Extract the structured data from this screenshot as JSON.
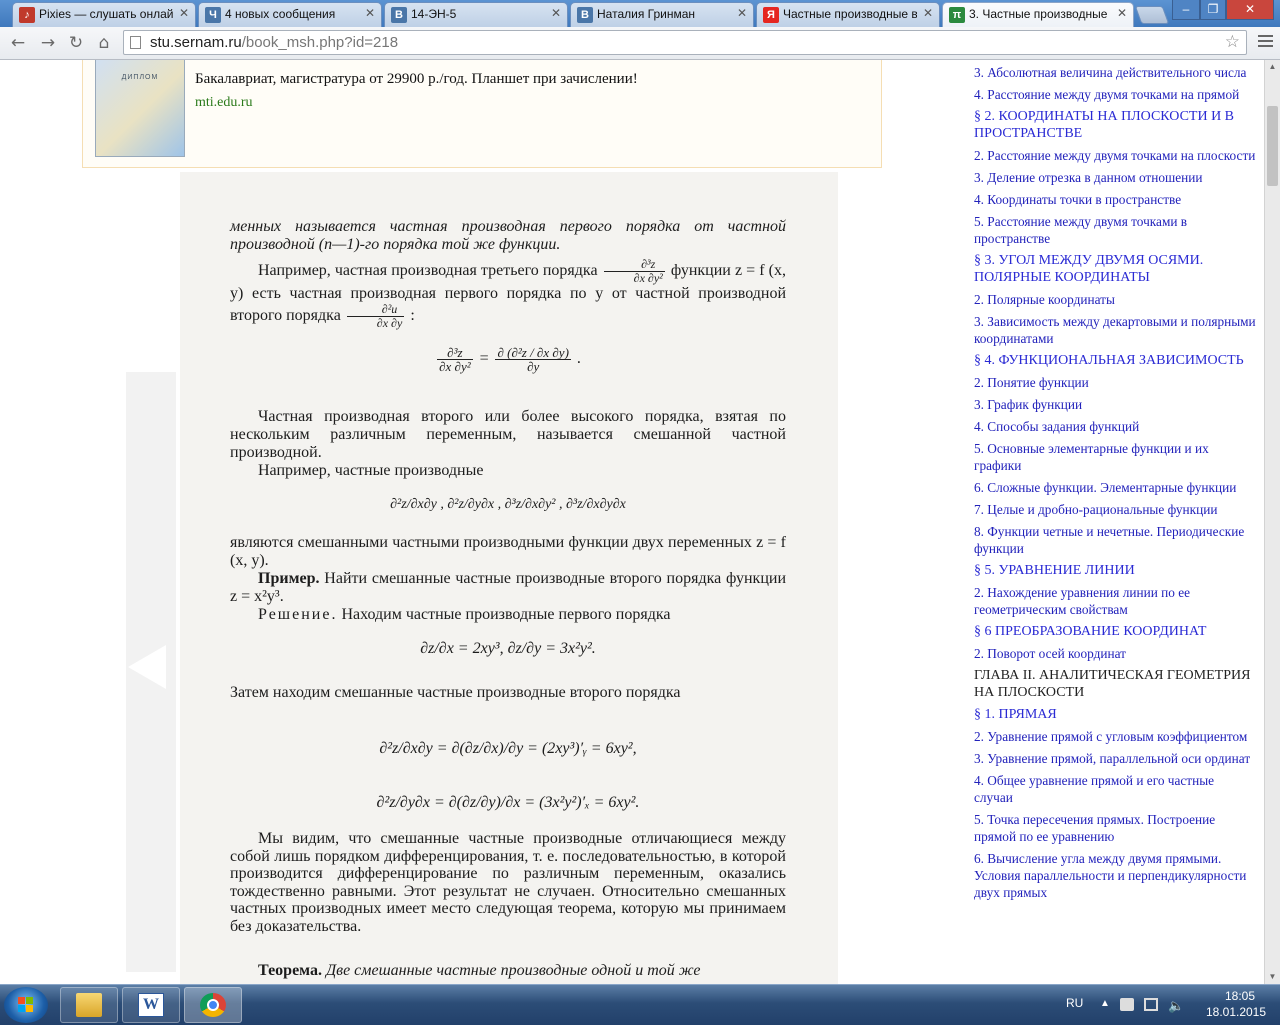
{
  "browser": {
    "tabs": [
      {
        "title": "Pixies — слушать онлайн",
        "icon": "music-note-icon",
        "color": "#c0392b",
        "active": false
      },
      {
        "title": "4 новых сообщения",
        "icon": "chat-icon",
        "color": "#4a76a8",
        "active": false
      },
      {
        "title": "14-ЭН-5",
        "icon": "vk-icon",
        "color": "#4a76a8",
        "active": false
      },
      {
        "title": "Наталия Гринман",
        "icon": "vk-icon",
        "color": "#4a76a8",
        "active": false
      },
      {
        "title": "Частные производные в",
        "icon": "yandex-icon",
        "color": "#e52620",
        "active": false
      },
      {
        "title": "3. Частные производные",
        "icon": "pi-icon",
        "color": "#2b8a3e",
        "active": true
      }
    ],
    "url_host": "stu.sernam.ru",
    "url_path": "/book_msh.php?id=218"
  },
  "ad": {
    "image_caption": "ДИПЛОМ",
    "text": "Бакалавриат, магистратура от 29900 р./год. Планшет при зачислении!",
    "url": "mti.edu.ru"
  },
  "book": {
    "p1": "менных называется частная производная первого порядка от частной производной (n—1)-го порядка той же функции.",
    "p2a": "Например, частная производная третьего порядка",
    "p2b": "функции z = f (x, y) есть частная производная первого порядка по y от частной производной второго порядка",
    "f_d3z_dxdy2_n": "∂³z",
    "f_d3z_dxdy2_d": "∂x ∂y²",
    "f_d2u_dxdy_n": "∂²u",
    "f_d2u_dxdy_d": "∂x ∂y",
    "eq1_rhs_n": "∂ (∂²z / ∂x ∂y)",
    "eq1_rhs_d": "∂y",
    "p3": "Частная производная второго или более высокого порядка, взятая по нескольким различным переменным, называется смешанной частной производной.",
    "p4": "Например, частные производные",
    "mixed_list": "∂²z/∂x∂y ,  ∂²z/∂y∂x ,  ∂³z/∂x∂y² ,  ∂³z/∂x∂y∂x",
    "p5": "являются смешанными частными производными функции двух переменных z = f (x, y).",
    "example_label": "Пример.",
    "example_text": "Найти смешанные частные производные второго порядка функции z = x²y³.",
    "solution_label": "Решение.",
    "solution_text": "Находим частные производные первого порядка",
    "first_order": "∂z/∂x = 2xy³,      ∂z/∂y = 3x²y².",
    "p6": "Затем находим смешанные частные производные второго порядка",
    "mixed_eq1": "∂²z/∂x∂y = ∂(∂z/∂x)/∂y = (2xy³)′ᵧ = 6xy²,",
    "mixed_eq2": "∂²z/∂y∂x = ∂(∂z/∂y)/∂x = (3x²y²)′ₓ = 6xy².",
    "p7a": "Мы видим, что смешанные частные производные",
    "p7b": "отличающиеся между собой лишь порядком дифференцирования, т. е. последовательностью, в которой производится дифференцирование по различным переменным, оказались тождественно равными. Этот результат не случаен. Относительно смешанных частных производных имеет место следующая теорема, которую мы принимаем без доказательства.",
    "theorem_label": "Теорема.",
    "theorem_text": "Две смешанные частные производные одной и той же"
  },
  "toc": [
    {
      "type": "link",
      "text": "3. Абсолютная величина действительного числа"
    },
    {
      "type": "link",
      "text": "4. Расстояние между двумя точками на прямой"
    },
    {
      "type": "section",
      "text": "§ 2. КООРДИНАТЫ НА ПЛОСКОСТИ И В ПРОСТРАНСТВЕ"
    },
    {
      "type": "link",
      "text": "2. Расстояние между двумя точками на плоскости"
    },
    {
      "type": "link",
      "text": "3. Деление отрезка в данном отношении"
    },
    {
      "type": "link",
      "text": "4. Координаты точки в пространстве"
    },
    {
      "type": "link",
      "text": "5. Расстояние между двумя точками в пространстве"
    },
    {
      "type": "section",
      "text": "§ 3. УГОЛ МЕЖДУ ДВУМЯ ОСЯМИ. ПОЛЯРНЫЕ КООРДИНАТЫ"
    },
    {
      "type": "link",
      "text": "2. Полярные координаты"
    },
    {
      "type": "link",
      "text": "3. Зависимость между декартовыми и полярными координатами"
    },
    {
      "type": "section",
      "text": "§ 4. ФУНКЦИОНАЛЬНАЯ ЗАВИСИМОСТЬ"
    },
    {
      "type": "link",
      "text": "2. Понятие функции"
    },
    {
      "type": "link",
      "text": "3. График функции"
    },
    {
      "type": "link",
      "text": "4. Способы задания функций"
    },
    {
      "type": "link",
      "text": "5. Основные элементарные функции и их графики"
    },
    {
      "type": "link",
      "text": "6. Сложные функции. Элементарные функции"
    },
    {
      "type": "link",
      "text": "7. Целые и дробно-рациональные функции"
    },
    {
      "type": "link",
      "text": "8. Функции четные и нечетные. Периодические функции"
    },
    {
      "type": "section",
      "text": "§ 5. УРАВНЕНИЕ ЛИНИИ"
    },
    {
      "type": "link",
      "text": "2. Нахождение уравнения линии по ее геометрическим свойствам"
    },
    {
      "type": "section",
      "text": "§ 6 ПРЕОБРАЗОВАНИЕ КООРДИНАТ"
    },
    {
      "type": "link",
      "text": "2. Поворот осей координат"
    },
    {
      "type": "head",
      "text": "ГЛАВА II. АНАЛИТИЧЕСКАЯ ГЕОМЕТРИЯ НА ПЛОСКОСТИ"
    },
    {
      "type": "section",
      "text": "§ 1. ПРЯМАЯ"
    },
    {
      "type": "link",
      "text": "2. Уравнение прямой с угловым коэффициентом"
    },
    {
      "type": "link",
      "text": "3. Уравнение прямой, параллельной оси ординат"
    },
    {
      "type": "link",
      "text": "4. Общее уравнение прямой и его частные случаи"
    },
    {
      "type": "link",
      "text": "5. Точка пересечения прямых. Построение прямой по ее уравнению"
    },
    {
      "type": "link",
      "text": "6. Вычисление угла между двумя прямыми. Условия параллельности и перпендикулярности двух прямых"
    }
  ],
  "taskbar": {
    "apps": [
      "explorer-folder-icon",
      "word-icon",
      "chrome-icon"
    ],
    "lang": "RU",
    "time": "18:05",
    "date": "18.01.2015"
  }
}
